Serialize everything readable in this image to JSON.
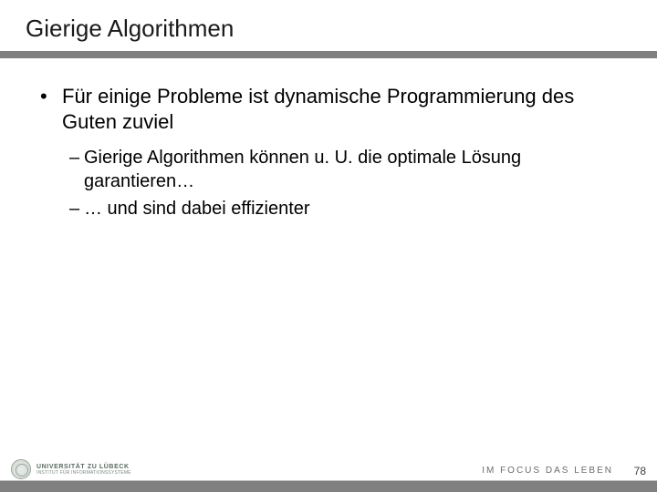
{
  "title": "Gierige Algorithmen",
  "bullets": [
    {
      "text": "Für einige Probleme ist dynamische Programmierung des Guten zuviel",
      "sub": [
        "Gierige Algorithmen können u. U. die optimale Lösung garantieren…",
        "… und sind dabei effizienter"
      ]
    }
  ],
  "footer": {
    "university_line1": "UNIVERSITÄT ZU LÜBECK",
    "university_line2": "INSTITUT FÜR INFORMATIONSSYSTEME",
    "tagline": "IM FOCUS DAS LEBEN",
    "page": "78"
  }
}
